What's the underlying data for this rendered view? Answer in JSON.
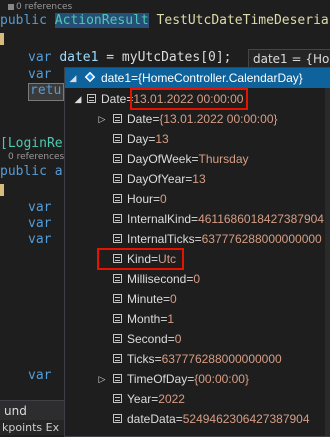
{
  "editor": {
    "refs_top": "0 references",
    "line1": {
      "prefix": "public ",
      "type": "ActionResult",
      "method": " TestUtcDateTimeDeseria"
    },
    "line2": {
      "kw": "var",
      "name": "date1",
      "rest": " = myUtcDates[0];"
    },
    "line3": {
      "kw": "var"
    },
    "line4": {
      "kw": "retu"
    },
    "line_login": "[LoginRe",
    "refs_mid": "0 references",
    "line_public": "public a",
    "vars": [
      "var",
      "var",
      "var"
    ],
    "line_var_bottom": "var",
    "mini_tip": "date1 = {Home"
  },
  "datatip": {
    "header": "date1={HomeController.CalendarDay}",
    "rows": [
      {
        "indent": 1,
        "expander": "expanded",
        "icon": "property-icon",
        "name": "Date",
        "eq": "=",
        "value": "13.01.2022 00:00:00",
        "highlight": true
      },
      {
        "indent": 2,
        "expander": "collapsed",
        "icon": "property-icon",
        "name": "Date",
        "eq": "=",
        "value": "{13.01.2022 00:00:00}"
      },
      {
        "indent": 2,
        "expander": "none",
        "icon": "property-icon",
        "name": "Day",
        "eq": "=",
        "value": "13"
      },
      {
        "indent": 2,
        "expander": "none",
        "icon": "property-icon",
        "name": "DayOfWeek",
        "eq": "=",
        "value": "Thursday"
      },
      {
        "indent": 2,
        "expander": "none",
        "icon": "property-icon",
        "name": "DayOfYear",
        "eq": "=",
        "value": "13"
      },
      {
        "indent": 2,
        "expander": "none",
        "icon": "property-icon",
        "name": "Hour",
        "eq": "=",
        "value": "0"
      },
      {
        "indent": 2,
        "expander": "none",
        "icon": "property-icon",
        "name": "InternalKind",
        "eq": "=",
        "value": "4611686018427387904"
      },
      {
        "indent": 2,
        "expander": "none",
        "icon": "property-icon",
        "name": "InternalTicks",
        "eq": "=",
        "value": "637776288000000000"
      },
      {
        "indent": 2,
        "expander": "none",
        "icon": "property-icon",
        "name": "Kind",
        "eq": "=",
        "value": "Utc",
        "highlight": true
      },
      {
        "indent": 2,
        "expander": "none",
        "icon": "property-icon",
        "name": "Millisecond",
        "eq": "=",
        "value": "0"
      },
      {
        "indent": 2,
        "expander": "none",
        "icon": "property-icon",
        "name": "Minute",
        "eq": "=",
        "value": "0"
      },
      {
        "indent": 2,
        "expander": "none",
        "icon": "property-icon",
        "name": "Month",
        "eq": "=",
        "value": "1"
      },
      {
        "indent": 2,
        "expander": "none",
        "icon": "property-icon",
        "name": "Second",
        "eq": "=",
        "value": "0"
      },
      {
        "indent": 2,
        "expander": "none",
        "icon": "property-icon",
        "name": "Ticks",
        "eq": "=",
        "value": "637776288000000000"
      },
      {
        "indent": 2,
        "expander": "collapsed",
        "icon": "property-icon",
        "name": "TimeOfDay",
        "eq": "=",
        "value": "{00:00:00}"
      },
      {
        "indent": 2,
        "expander": "none",
        "icon": "property-icon",
        "name": "Year",
        "eq": "=",
        "value": "2022"
      },
      {
        "indent": 2,
        "expander": "none",
        "icon": "property-icon",
        "name": "dateData",
        "eq": "=",
        "value": "5249462306427387904"
      }
    ]
  },
  "bottom": {
    "panel_label": "und",
    "tabs": "kpoints   Ex"
  },
  "colors": {
    "header_bg": "#0e639c",
    "highlight_border": "#e51400",
    "value_text": "#d69d85"
  }
}
